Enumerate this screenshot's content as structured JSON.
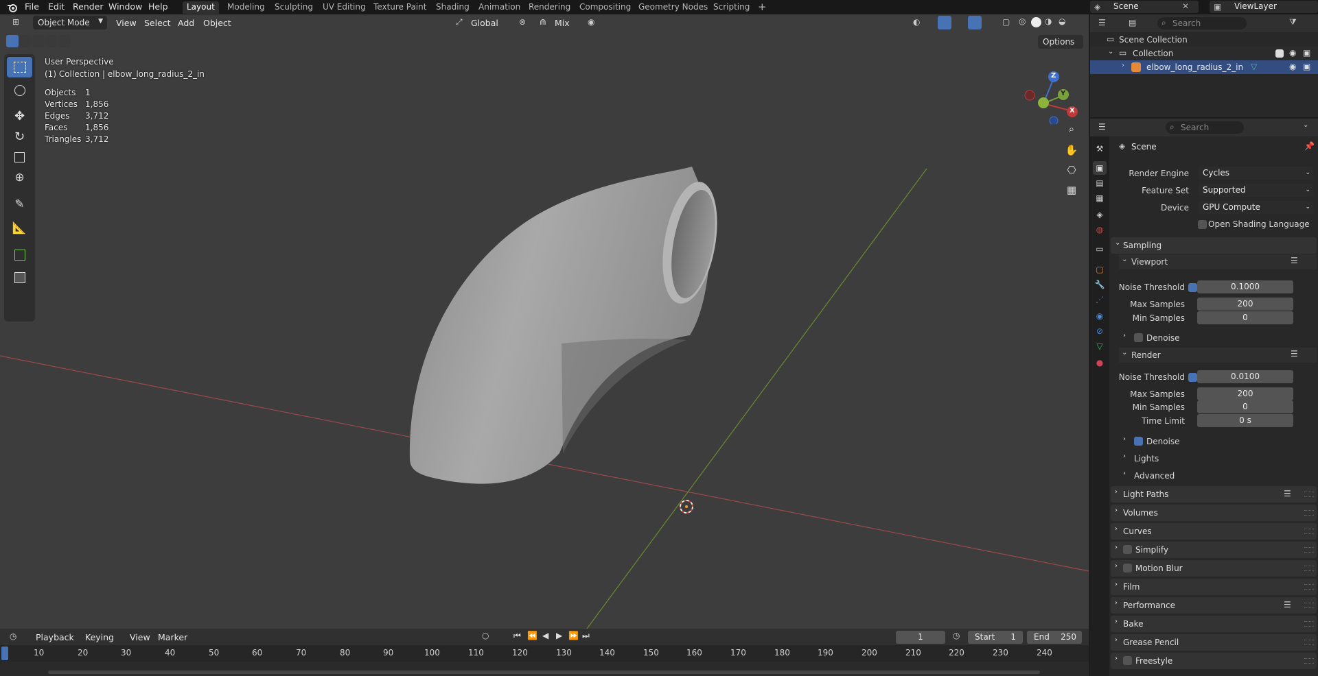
{
  "topbar": {
    "menus": [
      "File",
      "Edit",
      "Render",
      "Window",
      "Help"
    ],
    "workspaces": [
      "Layout",
      "Modeling",
      "Sculpting",
      "UV Editing",
      "Texture Paint",
      "Shading",
      "Animation",
      "Rendering",
      "Compositing",
      "Geometry Nodes",
      "Scripting"
    ],
    "active_workspace": "Layout",
    "scene": "Scene",
    "view_layer": "ViewLayer"
  },
  "viewport": {
    "mode": "Object Mode",
    "menus": [
      "View",
      "Select",
      "Add",
      "Object"
    ],
    "orientation": "Global",
    "snap_label": "Mix",
    "options_label": "Options",
    "perspective": "User Perspective",
    "collection_info": "(1) Collection | elbow_long_radius_2_in",
    "stats": [
      {
        "label": "Objects",
        "value": "1"
      },
      {
        "label": "Vertices",
        "value": "1,856"
      },
      {
        "label": "Edges",
        "value": "3,712"
      },
      {
        "label": "Faces",
        "value": "1,856"
      },
      {
        "label": "Triangles",
        "value": "3,712"
      }
    ],
    "gizmo": {
      "x": "X",
      "y": "Y",
      "z": "Z"
    }
  },
  "timeline": {
    "menus": [
      "Playback",
      "Keying",
      "View",
      "Marker"
    ],
    "current_frame": "1",
    "start_label": "Start",
    "start": "1",
    "end_label": "End",
    "end": "250",
    "ruler": [
      "10",
      "20",
      "30",
      "40",
      "50",
      "60",
      "70",
      "80",
      "90",
      "100",
      "110",
      "120",
      "130",
      "140",
      "150",
      "160",
      "170",
      "180",
      "190",
      "200",
      "210",
      "220",
      "230",
      "240"
    ]
  },
  "outliner": {
    "search_placeholder": "Search",
    "scene_collection": "Scene Collection",
    "collection": "Collection",
    "object": "elbow_long_radius_2_in"
  },
  "properties": {
    "search_placeholder": "Search",
    "context": "Scene",
    "render_engine_label": "Render Engine",
    "render_engine": "Cycles",
    "feature_set_label": "Feature Set",
    "feature_set": "Supported",
    "device_label": "Device",
    "device": "GPU Compute",
    "osl_label": "Open Shading Language",
    "sampling": "Sampling",
    "viewport": "Viewport",
    "vp_noise_label": "Noise Threshold",
    "vp_noise": "0.1000",
    "vp_max_label": "Max Samples",
    "vp_max": "200",
    "vp_min_label": "Min Samples",
    "vp_min": "0",
    "vp_denoise": "Denoise",
    "render": "Render",
    "r_noise_label": "Noise Threshold",
    "r_noise": "0.0100",
    "r_max_label": "Max Samples",
    "r_max": "200",
    "r_min_label": "Min Samples",
    "r_min": "0",
    "r_time_label": "Time Limit",
    "r_time": "0 s",
    "r_denoise": "Denoise",
    "lights": "Lights",
    "advanced": "Advanced",
    "panels": [
      "Light Paths",
      "Volumes",
      "Curves",
      "Simplify",
      "Motion Blur",
      "Film",
      "Performance",
      "Bake",
      "Grease Pencil",
      "Freestyle"
    ]
  }
}
